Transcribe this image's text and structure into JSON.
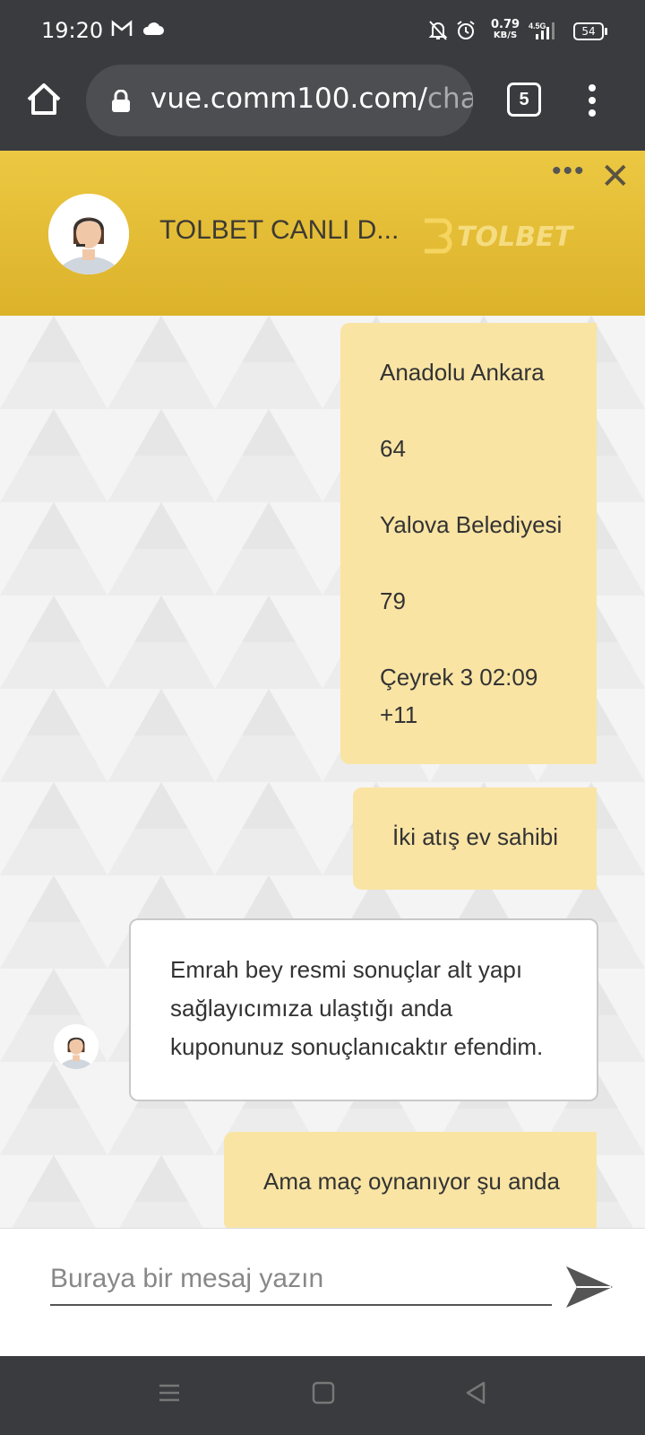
{
  "status_bar": {
    "time": "19:20",
    "net_speed_value": "0.79",
    "net_speed_unit": "KB/S",
    "network_type": "4.5G",
    "battery": "54",
    "icons": [
      "gmail-icon",
      "cloud-icon",
      "bell-off-icon",
      "alarm-icon",
      "signal-icon",
      "battery-icon"
    ]
  },
  "browser": {
    "url_main": "vue.comm100.com/",
    "url_dim": "chat",
    "tab_count": "5",
    "icons": [
      "home-icon",
      "lock-icon",
      "tabs-icon",
      "menu-kebab-icon"
    ]
  },
  "chat_header": {
    "agent_name": "TOLBET CANLI D...",
    "brand": "TOLBET",
    "colors": {
      "header_start": "#ecc842",
      "header_end": "#dcb22a"
    },
    "icons": [
      "more-dots-icon",
      "close-icon"
    ]
  },
  "messages": [
    {
      "from": "me",
      "lines": [
        "Anadolu Ankara",
        "64",
        "Yalova Belediyesi",
        "79",
        "Çeyrek 3 02:09",
        "+11"
      ]
    },
    {
      "from": "me",
      "lines": [
        "İki atış ev sahibi"
      ]
    },
    {
      "from": "agent",
      "lines": [
        "Emrah bey resmi sonuçlar alt yapı",
        "sağlayıcımıza ulaştığı anda",
        "kuponunuz sonuçlanıcaktır efendim."
      ]
    },
    {
      "from": "me",
      "lines": [
        "Ama maç oynanıyor şu anda"
      ]
    }
  ],
  "composer": {
    "placeholder": "Buraya bir mesaj yazın",
    "value": ""
  },
  "colors": {
    "my_bubble": "#f9e4a4",
    "agent_bubble": "#ffffff"
  },
  "nav_bar": {
    "icons": [
      "recents-icon",
      "home-square-icon",
      "back-icon"
    ]
  }
}
